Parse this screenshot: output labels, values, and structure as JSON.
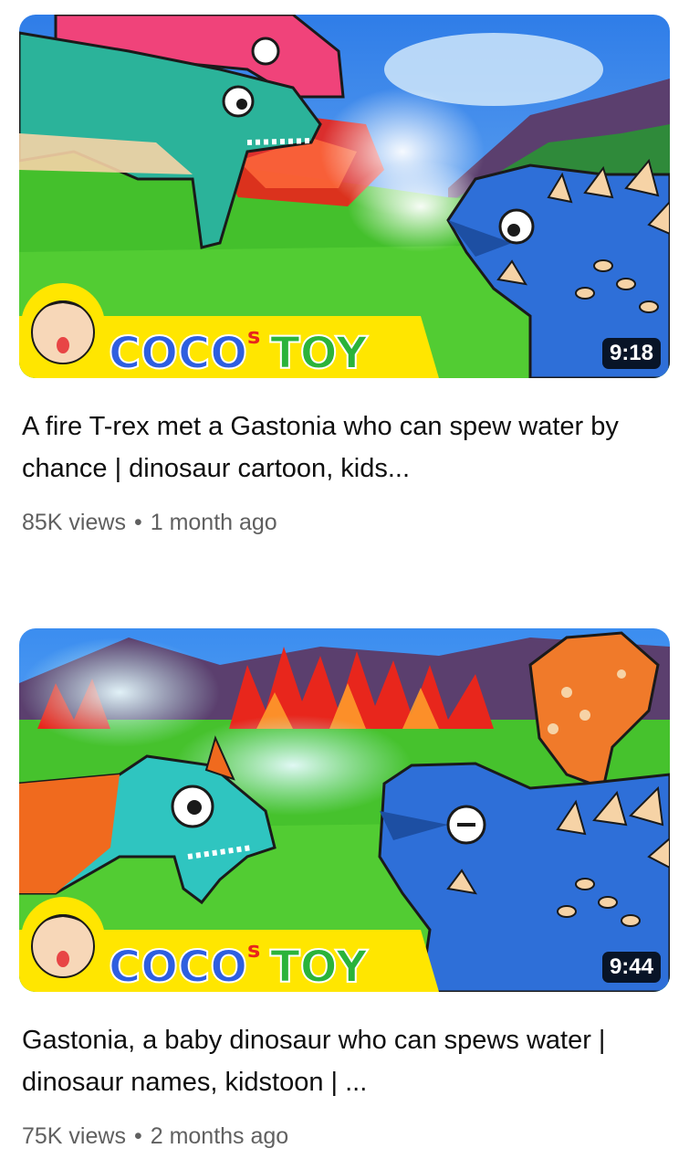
{
  "videos": [
    {
      "title": "A fire T-rex met a Gastonia who can spew water by chance | dinosaur cartoon, kids...",
      "duration": "9:18",
      "views": "85K views",
      "age": "1 month ago",
      "channel_logo_text": "COCO TOY"
    },
    {
      "title": "Gastonia, a baby dinosaur who can spews water | dinosaur names, kidstoon | ...",
      "duration": "9:44",
      "views": "75K views",
      "age": "2 months ago",
      "channel_logo_text": "COCO TOY"
    }
  ],
  "meta_separator": "•",
  "colors": {
    "banner_yellow": "#ffe600",
    "grass": "#4cc72e",
    "sky": "#3b8df0",
    "gastonia_blue": "#2e6fd8",
    "trex_green": "#2bb39a",
    "trex_pink": "#f0437a",
    "fire_red": "#e8261c"
  }
}
